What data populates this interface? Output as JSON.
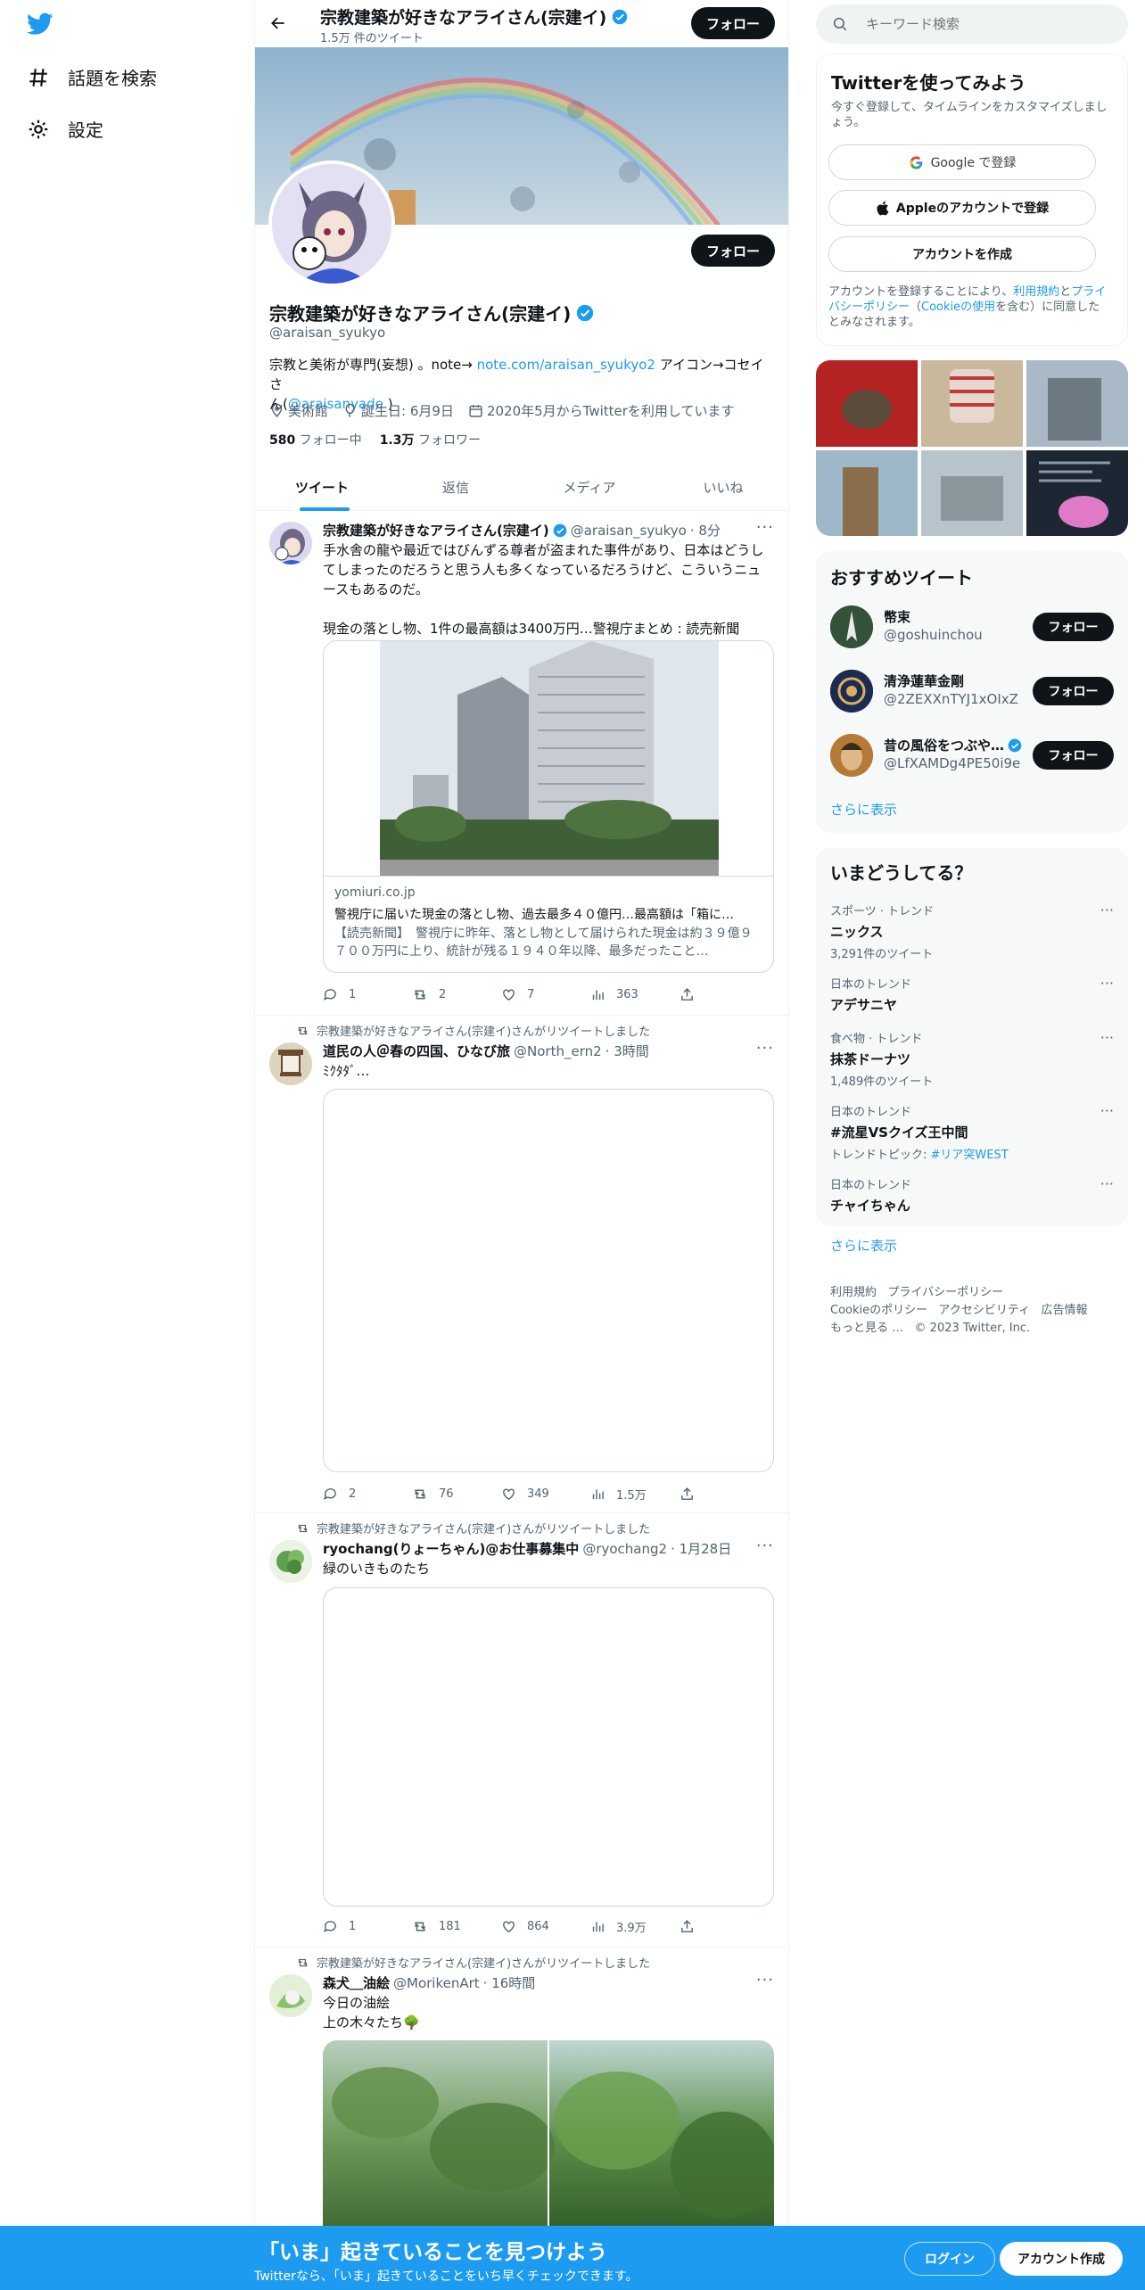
{
  "colors": {
    "accent": "#1d9bf0",
    "text": "#0f1419",
    "secondary": "#536471",
    "banner": "#1d9bf0"
  },
  "nav": {
    "logo": "twitter-bird-icon",
    "items": [
      {
        "icon": "hashtag-icon",
        "label": "話題を検索"
      },
      {
        "icon": "gear-icon",
        "label": "設定"
      }
    ]
  },
  "header": {
    "name": "宗教建築が好きなアライさん(宗建イ)",
    "tweet_count": "1.5万 件のツイート",
    "follow_label": "フォロー"
  },
  "profile": {
    "name": "宗教建築が好きなアライさん(宗建イ)",
    "handle": "@araisan_syukyo",
    "bio_prefix": "宗教と美術が専門(妄想) 。note→ ",
    "bio_link": "note.com/araisan_syukyo2",
    "bio_mid": " アイコン→コセイさ",
    "bio_line2_prefix": "ん(",
    "bio_mention": "@araisanyade",
    "bio_line2_suffix": " )",
    "location": "美術館",
    "birthday": "誕生日: 6月9日",
    "joined": "2020年5月からTwitterを利用しています",
    "following_count": "580",
    "following_label": " フォロー中",
    "followers_count": "1.3万",
    "followers_label": " フォロワー",
    "follow_label": "フォロー"
  },
  "tabs": [
    "ツイート",
    "返信",
    "メディア",
    "いいね"
  ],
  "tweets": [
    {
      "name": "宗教建築が好きなアライさん(宗建イ)",
      "handle": "@araisan_syukyo",
      "time": "· 8分",
      "text": "手水舎の龍や最近ではびんずる尊者が盗まれた事件があり、日本はどうしてしまったのだろうと思う人も多くなっているだろうけど、こういうニュースもあるのだ。\n\n現金の落とし物、1件の最高額は3400万円…警視庁まとめ : 読売新聞",
      "card_domain": "yomiuri.co.jp",
      "card_title": "警視庁に届いた現金の落とし物、過去最多４０億円…最高額は「箱に…",
      "card_desc": "【読売新聞】　警視庁に昨年、落とし物として届けられた現金は約３９億９７００万円に上り、統計が残る１９４０年以降、最多だったこと…",
      "replies": "1",
      "retweets": "2",
      "likes": "7",
      "views": "363"
    },
    {
      "retweeted_by": "宗教建築が好きなアライさん(宗建イ)さんがリツイートしました",
      "name": "道民の人＠春の四国、ひなび旅",
      "handle": "@North_ern2",
      "time": "· 3時間",
      "text": "ﾐｸﾀﾀﾞ…",
      "replies": "2",
      "retweets": "76",
      "likes": "349",
      "views": "1.5万"
    },
    {
      "retweeted_by": "宗教建築が好きなアライさん(宗建イ)さんがリツイートしました",
      "name": "ryochang(りょーちゃん)@お仕事募集中",
      "handle": "@ryochang2",
      "time": "· 1月28日",
      "text": "緑のいきものたち",
      "replies": "1",
      "retweets": "181",
      "likes": "864",
      "views": "3.9万"
    },
    {
      "retweeted_by": "宗教建築が好きなアライさん(宗建イ)さんがリツイートしました",
      "name": "森犬＿油絵",
      "handle": "@MorikenArt",
      "time": "· 16時間",
      "text": "今日の油絵\n上の木々たち🌳"
    }
  ],
  "search": {
    "placeholder": "キーワード検索"
  },
  "signup": {
    "title": "Twitterを使ってみよう",
    "subtitle": "今すぐ登録して、タイムラインをカスタマイズしましょう。",
    "google": "Google で登録",
    "apple": "Appleのアカウントで登録",
    "create": "アカウントを作成",
    "terms_1": "アカウントを登録することにより、",
    "terms_link1": "利用規約",
    "terms_2": "と",
    "terms_link2": "プライバシーポリシー",
    "terms_3": "（",
    "terms_link3": "Cookieの使用",
    "terms_4": "を含む）に同意したとみなされます。"
  },
  "recommended": {
    "title": "おすすめツイート",
    "users": [
      {
        "name": "幣束",
        "handle": "@goshuinchou",
        "follow": "フォロー"
      },
      {
        "name": "清浄蓮華金剛",
        "handle": "@2ZEXXnTYJ1xOIxZ",
        "follow": "フォロー"
      },
      {
        "name": "昔の風俗をつぶや…",
        "handle": "@LfXAMDg4PE50i9e",
        "follow": "フォロー"
      }
    ],
    "more": "さらに表示"
  },
  "trends": {
    "title": "いまどうしてる？",
    "items": [
      {
        "category": "スポーツ · トレンド",
        "name": "ニックス",
        "count": "3,291件のツイート"
      },
      {
        "category": "日本のトレンド",
        "name": "アデサニヤ",
        "count": ""
      },
      {
        "category": "食べ物 · トレンド",
        "name": "抹茶ドーナツ",
        "count": "1,489件のツイート"
      },
      {
        "category": "日本のトレンド",
        "name": "#流星VSクイズ王中間",
        "count_prefix": "トレンドトピック: ",
        "count_link": "#リア突WEST"
      },
      {
        "category": "日本のトレンド",
        "name": "チャイちゃん",
        "count": ""
      }
    ],
    "more": "さらに表示"
  },
  "footer": {
    "links": [
      "利用規約",
      "プライバシーポリシー",
      "Cookieのポリシー",
      "アクセシビリティ",
      "広告情報",
      "もっと見る …"
    ],
    "copyright": "© 2023 Twitter, Inc."
  },
  "banner": {
    "title": "「いま」起きていることを見つけよう",
    "subtitle": "Twitterなら、「いま」起きていることをいち早くチェックできます。",
    "login": "ログイン",
    "signup": "アカウント作成"
  }
}
